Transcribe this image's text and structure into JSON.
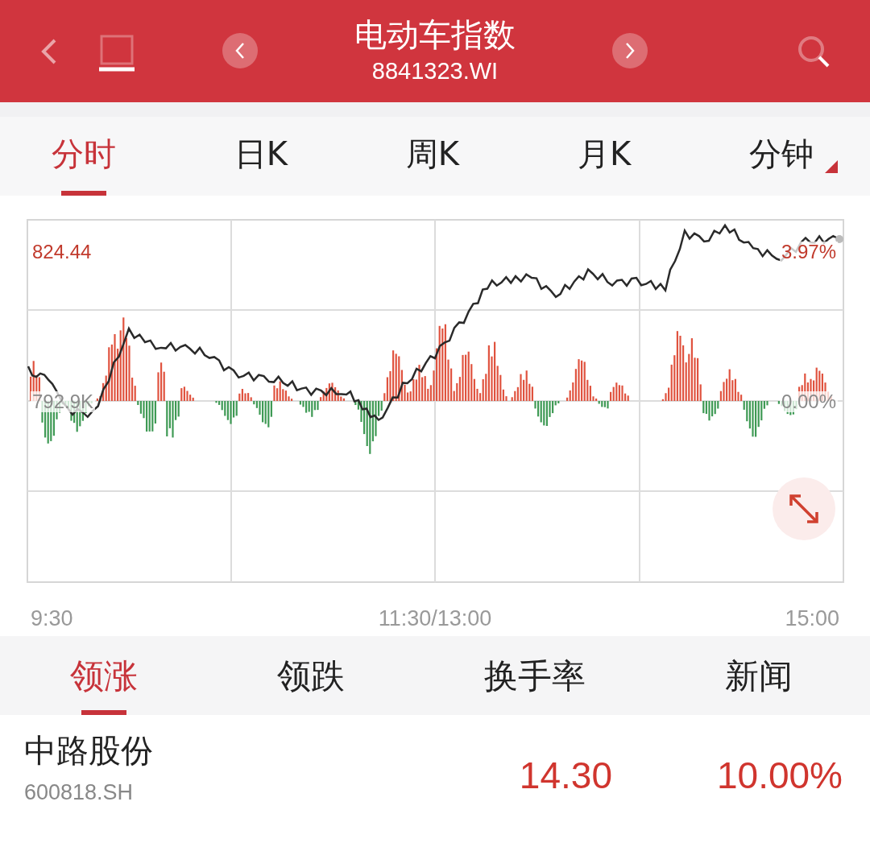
{
  "header": {
    "title": "电动车指数",
    "code": "8841323.WI"
  },
  "chart_tabs": [
    {
      "label": "分时",
      "selected": true,
      "kind": "plain"
    },
    {
      "label": "日K",
      "selected": false,
      "kind": "plain"
    },
    {
      "label": "周K",
      "selected": false,
      "kind": "plain"
    },
    {
      "label": "月K",
      "selected": false,
      "kind": "plain"
    },
    {
      "label": "分钟",
      "selected": false,
      "kind": "dropdown"
    }
  ],
  "chart": {
    "price_high": "824.44",
    "change_high": "3.97%",
    "volume": "792.9K",
    "change_base": "0.00%",
    "time_labels": [
      "9:30",
      "11:30/13:00",
      "15:00"
    ]
  },
  "list_tabs": [
    {
      "label": "领涨",
      "selected": true
    },
    {
      "label": "领跌",
      "selected": false
    },
    {
      "label": "换手率",
      "selected": false
    },
    {
      "label": "新闻",
      "selected": false
    }
  ],
  "stocks": [
    {
      "name": "中路股份",
      "code": "600818.SH",
      "price": "14.30",
      "change": "10.00%"
    }
  ]
}
